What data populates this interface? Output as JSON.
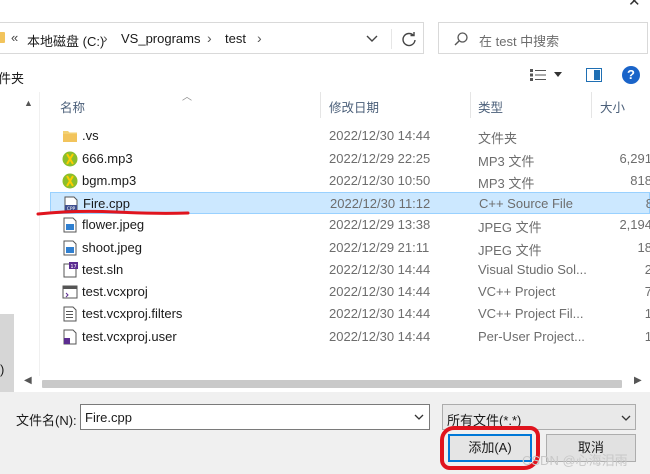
{
  "address_bar": {
    "chevron": "«",
    "crumbs": [
      "本地磁盘 (C:)",
      "VS_programs",
      "test"
    ],
    "search_placeholder": "在 test 中搜索"
  },
  "toolbar": {
    "new_folder_label": "件夹"
  },
  "columns": {
    "name": "名称",
    "date": "修改日期",
    "type": "类型",
    "size": "大小"
  },
  "files": [
    {
      "name": ".vs",
      "date": "2022/12/30 14:44",
      "type": "文件夹",
      "size": "",
      "icon": "folder-icon"
    },
    {
      "name": "666.mp3",
      "date": "2022/12/29 22:25",
      "type": "MP3 文件",
      "size": "6,291",
      "icon": "audio-file-icon"
    },
    {
      "name": "bgm.mp3",
      "date": "2022/12/30 10:50",
      "type": "MP3 文件",
      "size": "818",
      "icon": "audio-file-icon"
    },
    {
      "name": "Fire.cpp",
      "date": "2022/12/30 11:12",
      "type": "C++ Source File",
      "size": "8",
      "icon": "cpp-file-icon",
      "selected": true
    },
    {
      "name": "flower.jpeg",
      "date": "2022/12/29 13:38",
      "type": "JPEG 文件",
      "size": "2,194",
      "icon": "image-file-icon"
    },
    {
      "name": "shoot.jpeg",
      "date": "2022/12/29 21:11",
      "type": "JPEG 文件",
      "size": "18",
      "icon": "image-file-icon"
    },
    {
      "name": "test.sln",
      "date": "2022/12/30 14:44",
      "type": "Visual Studio Sol...",
      "size": "2",
      "icon": "sln-file-icon"
    },
    {
      "name": "test.vcxproj",
      "date": "2022/12/30 14:44",
      "type": "VC++ Project",
      "size": "7",
      "icon": "vcxproj-file-icon"
    },
    {
      "name": "test.vcxproj.filters",
      "date": "2022/12/30 14:44",
      "type": "VC++ Project Fil...",
      "size": "1",
      "icon": "filters-file-icon"
    },
    {
      "name": "test.vcxproj.user",
      "date": "2022/12/30 14:44",
      "type": "Per-User Project...",
      "size": "1",
      "icon": "user-file-icon"
    }
  ],
  "nav_pane": {
    "partial_text": ")"
  },
  "bottom": {
    "filename_label": "文件名(N):",
    "filename_value": "Fire.cpp",
    "filetype_value": "所有文件(*.*)",
    "add_label": "添加(A)",
    "cancel_label": "取消",
    "watermark": "CSDN @心海泪雨"
  },
  "colors": {
    "selection": "#cce8ff",
    "selection_border": "#99d1ff",
    "accent": "#0078d7",
    "annotation_red": "#e0141e"
  }
}
